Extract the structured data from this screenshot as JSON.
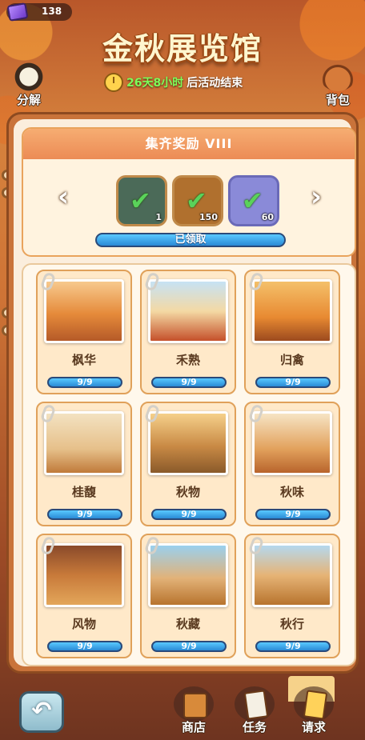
{
  "currency": {
    "icon": "purple-gem-icon",
    "amount": "138"
  },
  "event": {
    "title": "金秋展览馆",
    "timer_highlight": "26天8小时",
    "timer_suffix": "后活动结束"
  },
  "side_buttons": {
    "decompose": "分解",
    "backpack": "背包"
  },
  "reward": {
    "title": "集齐奖励 VIII",
    "items": [
      {
        "icon": "armor-icon",
        "qty": "1"
      },
      {
        "icon": "maple-leaf-icon",
        "qty": "150"
      },
      {
        "icon": "card-pack-icon",
        "qty": "60"
      }
    ],
    "status": "已领取"
  },
  "collections": [
    {
      "name": "枫华",
      "progress": "9/9"
    },
    {
      "name": "禾熟",
      "progress": "9/9"
    },
    {
      "name": "归禽",
      "progress": "9/9"
    },
    {
      "name": "桂馥",
      "progress": "9/9"
    },
    {
      "name": "秋物",
      "progress": "9/9"
    },
    {
      "name": "秋味",
      "progress": "9/9"
    },
    {
      "name": "风物",
      "progress": "9/9"
    },
    {
      "name": "秋藏",
      "progress": "9/9"
    },
    {
      "name": "秋行",
      "progress": "9/9"
    }
  ],
  "nav": {
    "shop": "商店",
    "tasks": "任务",
    "request": "请求"
  },
  "colors": {
    "accent_blue": "#2a8ad6",
    "timer_green": "#7dff5a",
    "panel_orange": "#c9733a"
  }
}
